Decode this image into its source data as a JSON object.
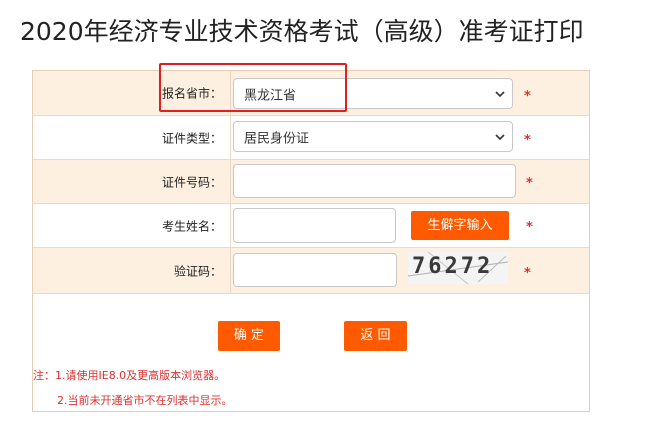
{
  "page": {
    "title": "2020年经济专业技术资格考试（高级）准考证打印"
  },
  "form": {
    "province": {
      "label": "报名省市：",
      "value": "黑龙江省"
    },
    "id_type": {
      "label": "证件类型：",
      "value": "居民身份证"
    },
    "id_number": {
      "label": "证件号码：",
      "value": ""
    },
    "name": {
      "label": "考生姓名：",
      "value": "",
      "rare_char_button": "生僻字输入"
    },
    "captcha": {
      "label": "验证码：",
      "value": "",
      "image_text": "76272"
    },
    "required_mark": "*"
  },
  "buttons": {
    "confirm": "确 定",
    "back": "返 回"
  },
  "notes": {
    "line1": "注：1.请使用IE8.0及更高版本浏览器。",
    "line2": "2.当前未开通省市不在列表中显示。"
  },
  "colors": {
    "accent": "#ff5a00",
    "required": "#e03030",
    "highlight": "#e02020",
    "row_shade": "#fdf0e1"
  }
}
